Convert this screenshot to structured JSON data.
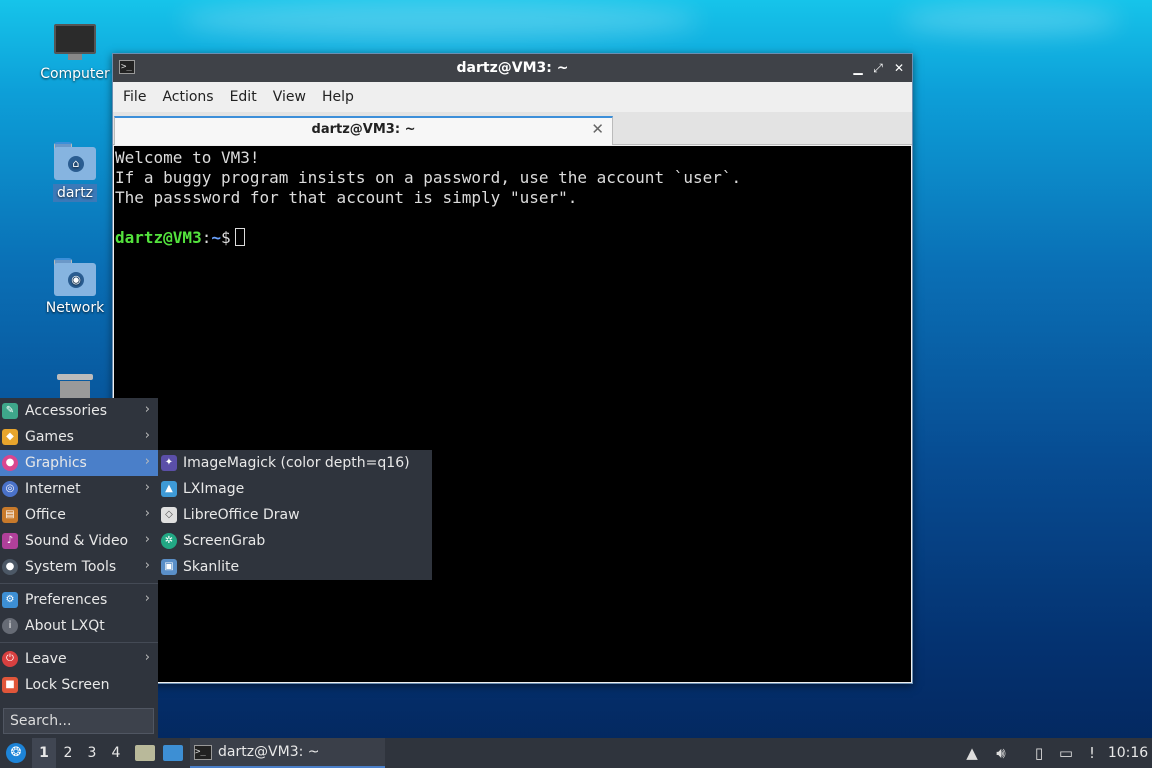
{
  "desktop": {
    "icons": [
      {
        "label": "Computer"
      },
      {
        "label": "dartz"
      },
      {
        "label": "Network"
      }
    ]
  },
  "window": {
    "title": "dartz@VM3: ~",
    "buttons": {
      "minimize": "▁",
      "maximize": "⤢",
      "close": "✕"
    },
    "menu": [
      "File",
      "Actions",
      "Edit",
      "View",
      "Help"
    ],
    "tab": {
      "label": "dartz@VM3: ~",
      "close": "✕"
    },
    "terminal": {
      "lines": [
        "Welcome to VM3!",
        "If a buggy program insists on a password, use the account `user`.",
        "The passsword for that account is simply \"user\"."
      ],
      "prompt_user": "dartz@VM3",
      "prompt_sep": ":",
      "prompt_path": "~",
      "prompt_symbol": "$"
    }
  },
  "startmenu": {
    "items": [
      {
        "label": "Accessories",
        "icon": "accessories-icon",
        "color": "#3ea78a"
      },
      {
        "label": "Games",
        "icon": "games-icon",
        "color": "#e8a52c"
      },
      {
        "label": "Graphics",
        "icon": "graphics-icon",
        "color": "#d9468f"
      },
      {
        "label": "Internet",
        "icon": "internet-icon",
        "color": "#4a72c9"
      },
      {
        "label": "Office",
        "icon": "office-icon",
        "color": "#c87a2b"
      },
      {
        "label": "Sound & Video",
        "icon": "sound-video-icon",
        "color": "#b0409a"
      },
      {
        "label": "System Tools",
        "icon": "system-tools-icon",
        "color": "#4c5866"
      },
      {
        "label": "Preferences",
        "icon": "preferences-icon",
        "color": "#3d8fd4"
      },
      {
        "label": "About LXQt",
        "icon": "about-icon",
        "color": "#666b75"
      },
      {
        "label": "Leave",
        "icon": "leave-icon",
        "color": "#d84040"
      },
      {
        "label": "Lock Screen",
        "icon": "lock-icon",
        "color": "#e0563a"
      }
    ],
    "search_placeholder": "Search..."
  },
  "submenu": {
    "items": [
      {
        "label": "ImageMagick (color depth=q16)",
        "icon": "imagemagick-icon",
        "color": "#5b4fa8"
      },
      {
        "label": "LXImage",
        "icon": "lximage-icon",
        "color": "#3e9ad6"
      },
      {
        "label": "LibreOffice Draw",
        "icon": "libreoffice-draw-icon",
        "color": "#e0e0e0"
      },
      {
        "label": "ScreenGrab",
        "icon": "screengrab-icon",
        "color": "#22a884"
      },
      {
        "label": "Skanlite",
        "icon": "skanlite-icon",
        "color": "#5a8fc8"
      }
    ]
  },
  "taskbar": {
    "workspaces": [
      "1",
      "2",
      "3",
      "4"
    ],
    "task_label": "dartz@VM3: ~",
    "clock": "10:16"
  }
}
